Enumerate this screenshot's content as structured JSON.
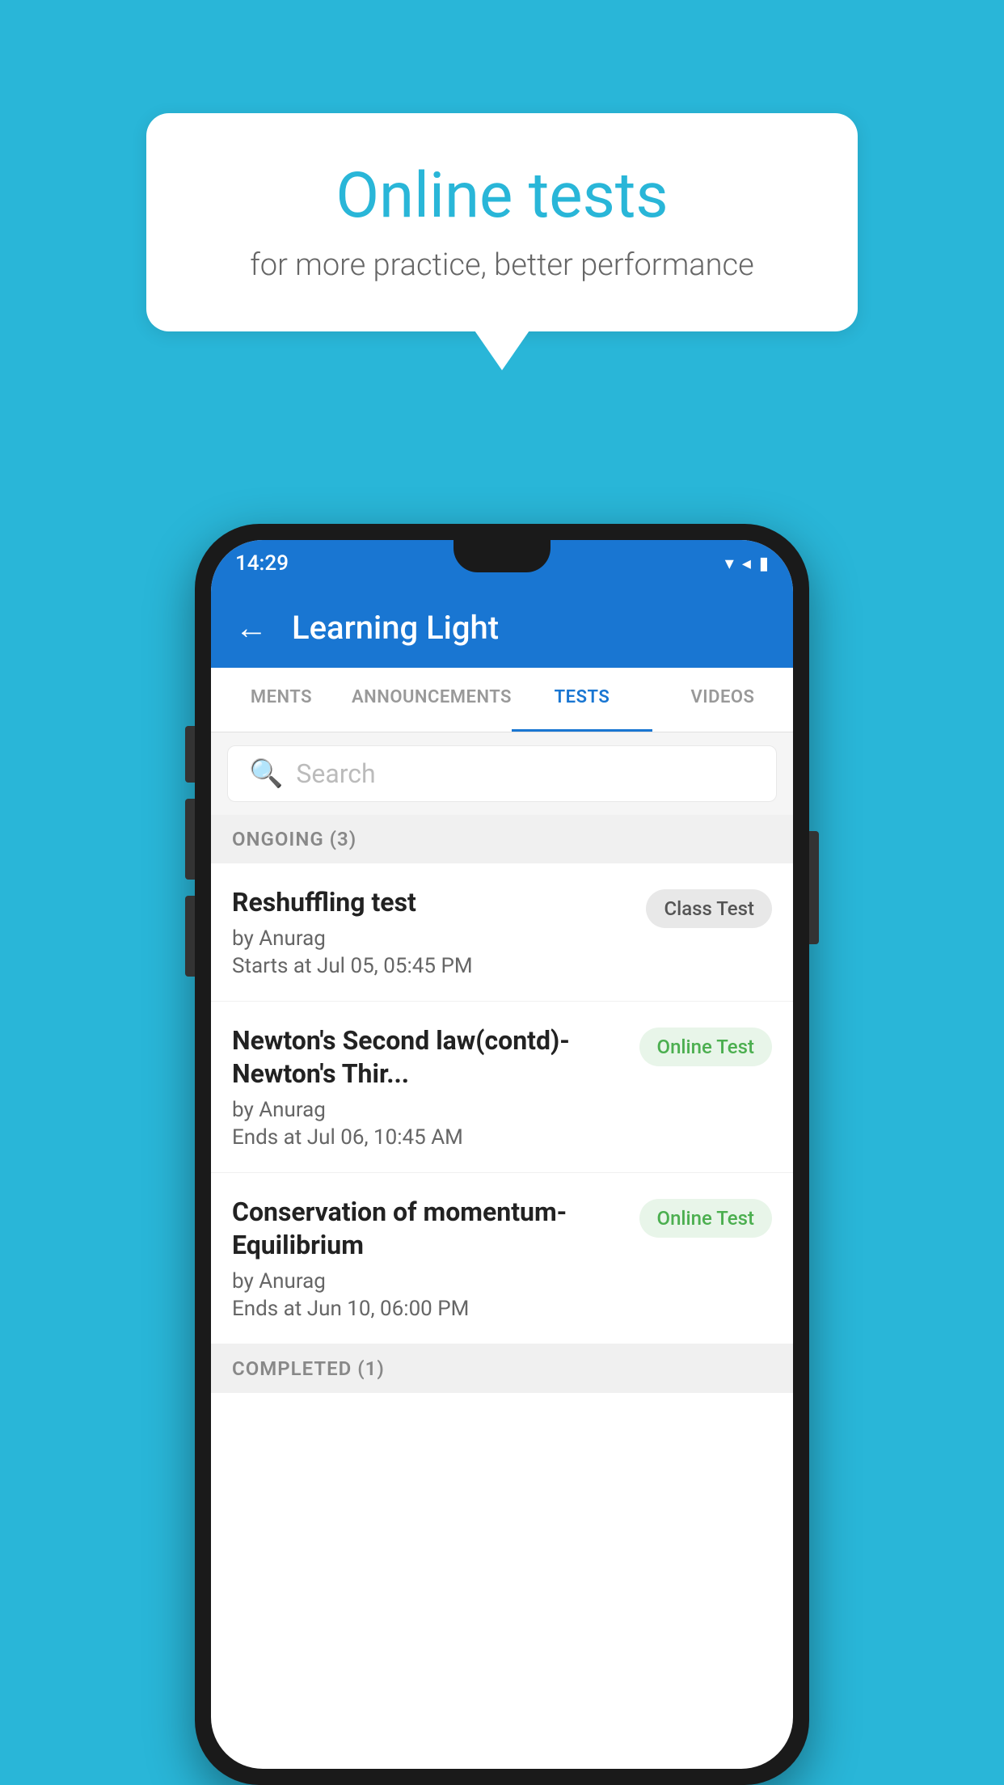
{
  "background_color": "#29b6d8",
  "speech_bubble": {
    "title": "Online tests",
    "subtitle": "for more practice, better performance"
  },
  "phone": {
    "status_bar": {
      "time": "14:29",
      "icons": "▼◀▮"
    },
    "app_bar": {
      "title": "Learning Light",
      "back_label": "←"
    },
    "tabs": [
      {
        "label": "MENTS",
        "active": false
      },
      {
        "label": "ANNOUNCEMENTS",
        "active": false
      },
      {
        "label": "TESTS",
        "active": true
      },
      {
        "label": "VIDEOS",
        "active": false
      }
    ],
    "search": {
      "placeholder": "Search"
    },
    "section_ongoing": {
      "label": "ONGOING (3)"
    },
    "tests": [
      {
        "title": "Reshuffling test",
        "author": "by Anurag",
        "date": "Starts at  Jul 05, 05:45 PM",
        "badge": "Class Test",
        "badge_type": "class"
      },
      {
        "title": "Newton's Second law(contd)-Newton's Thir...",
        "author": "by Anurag",
        "date": "Ends at  Jul 06, 10:45 AM",
        "badge": "Online Test",
        "badge_type": "online"
      },
      {
        "title": "Conservation of momentum-Equilibrium",
        "author": "by Anurag",
        "date": "Ends at  Jun 10, 06:00 PM",
        "badge": "Online Test",
        "badge_type": "online"
      }
    ],
    "section_completed": {
      "label": "COMPLETED (1)"
    }
  }
}
